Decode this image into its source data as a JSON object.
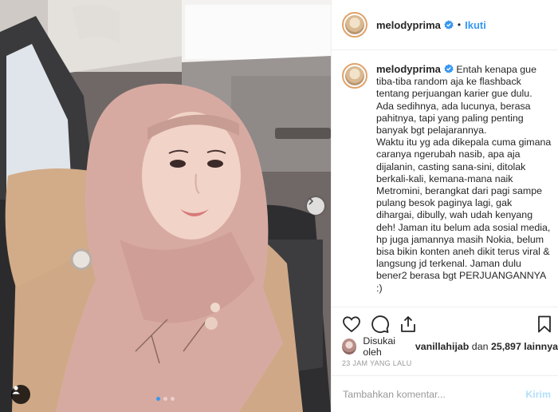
{
  "header": {
    "username": "melodyprima",
    "separator": "•",
    "follow_label": "Ikuti"
  },
  "caption": {
    "username": "melodyprima",
    "text": "Entah kenapa gue tiba-tiba random aja ke flashback tentang perjuangan karier gue dulu. Ada sedihnya, ada lucunya, berasa pahitnya, tapi yang paling penting banyak bgt pelajarannya.\nWaktu itu yg ada dikepala cuma gimana caranya ngerubah nasib, apa aja dijalanin, casting sana-sini, ditolak berkali-kali, kemana-mana naik Metromini, berangkat dari pagi sampe pulang besok paginya lagi, gak dihargai, dibully, wah udah kenyang deh! Jaman itu belum ada sosial media, hp juga jamannya masih Nokia, belum bisa bikin konten aneh dikit terus viral & langsung jd terkenal. Jaman dulu bener2 berasa bgt PERJUANGANNYA :)"
  },
  "likes": {
    "prefix": "Disukai oleh",
    "user": "vanillahijab",
    "middle": "dan",
    "count": "25,897",
    "suffix": "lainnya"
  },
  "timestamp": "23 JAM YANG LALU",
  "comment_box": {
    "placeholder": "Tambahkan komentar...",
    "post_label": "Kirim"
  },
  "carousel": {
    "slides": 3,
    "active_index": 0
  },
  "icons": {
    "verified": "verified-badge-icon",
    "like": "heart-icon",
    "comment": "comment-icon",
    "share": "share-icon",
    "save": "bookmark-icon",
    "next": "chevron-right-icon",
    "tag": "user-tag-icon"
  },
  "colors": {
    "link": "#3897f0",
    "text": "#262626",
    "muted": "#999999",
    "post_disabled": "#b2dffc"
  }
}
